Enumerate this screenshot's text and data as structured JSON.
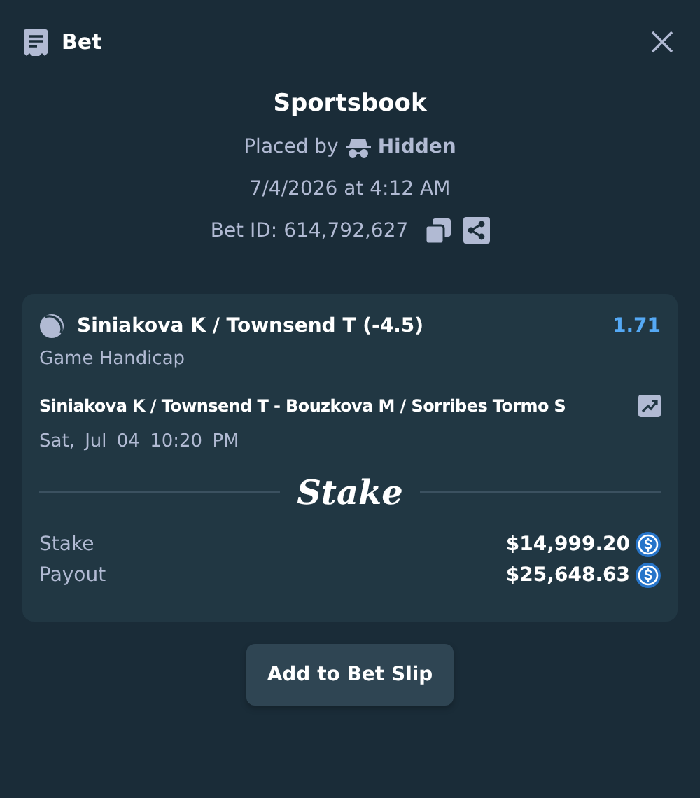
{
  "header": {
    "title": "Bet"
  },
  "summary": {
    "title": "Sportsbook",
    "placed_by_label": "Placed by",
    "placed_by_user": "Hidden",
    "datetime": "7/4/2026 at 4:12 AM",
    "bet_id": "Bet ID: 614,792,627"
  },
  "selection": {
    "name": "Siniakova K / Townsend T (-4.5)",
    "odds": "1.71",
    "market": "Game Handicap",
    "event": "Siniakova K / Townsend T - Bouzkova M / Sorribes Tormo S",
    "date": "Sat, Jul 04",
    "time": "10:20 PM"
  },
  "brand": "Stake",
  "totals": [
    {
      "label": "Stake",
      "amount": "$14,999.20"
    },
    {
      "label": "Payout",
      "amount": "$25,648.63"
    }
  ],
  "button": "Add to Bet Slip"
}
